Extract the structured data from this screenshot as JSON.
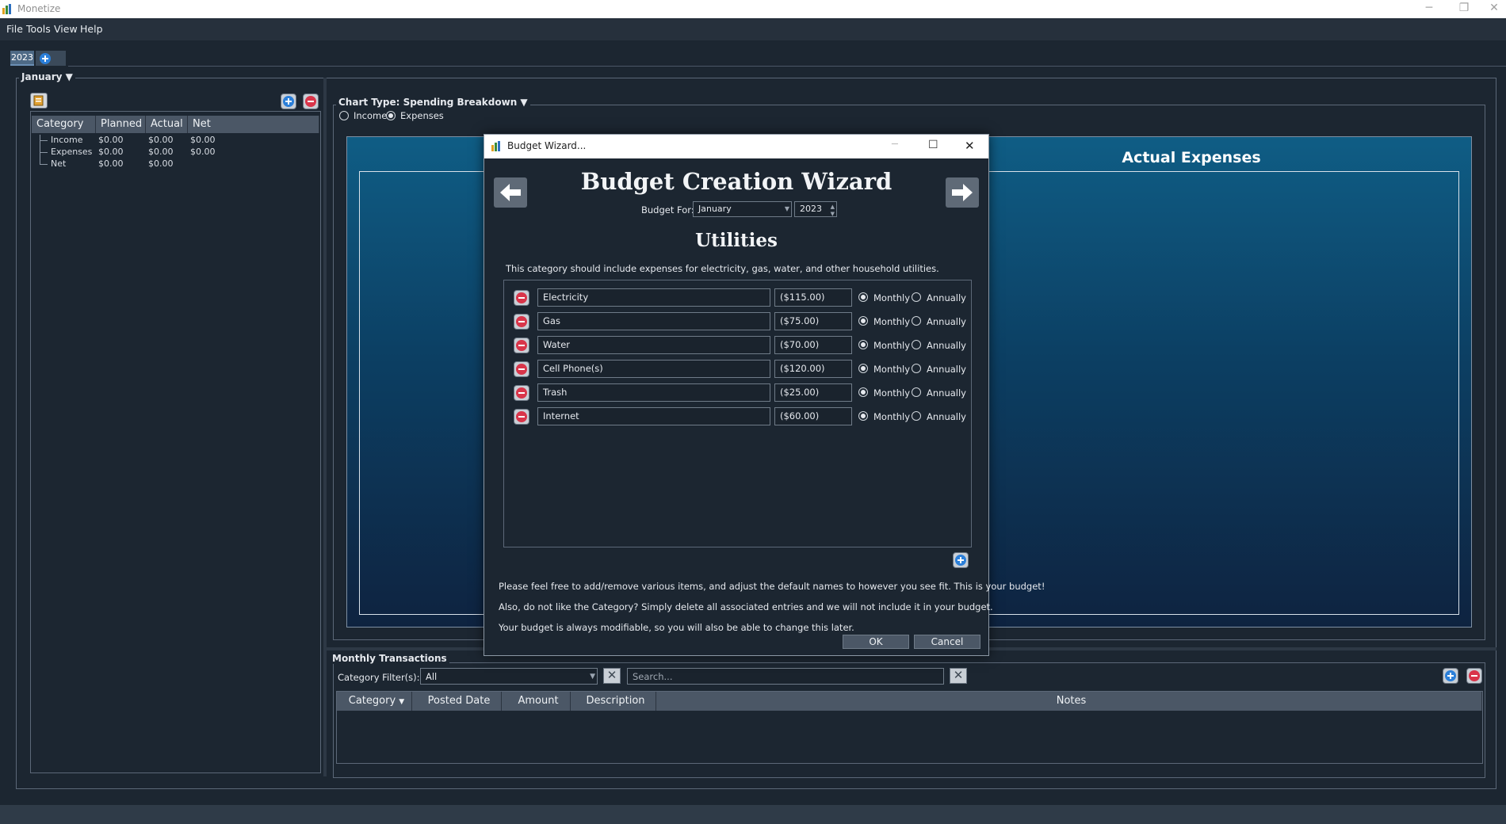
{
  "window": {
    "title": "Monetize",
    "controls": {
      "minimize": "─",
      "restore": "❐",
      "close": "✕"
    }
  },
  "menu": [
    "File",
    "Tools",
    "View",
    "Help"
  ],
  "tabs": {
    "year": "2023"
  },
  "month_selector": {
    "label": "January ▼"
  },
  "summary": {
    "columns": [
      "Category",
      "Planned",
      "Actual",
      "Net"
    ],
    "rows": [
      {
        "name": "Income",
        "planned": "$0.00",
        "actual": "$0.00",
        "net": "$0.00"
      },
      {
        "name": "Expenses",
        "planned": "$0.00",
        "actual": "$0.00",
        "net": "$0.00"
      },
      {
        "name": "Net",
        "planned": "$0.00",
        "actual": "$0.00",
        "net": ""
      }
    ]
  },
  "chart_panel": {
    "chart_type_label": "Chart Type: Spending Breakdown ▼",
    "options": [
      "Income",
      "Expenses"
    ],
    "selected": "Expenses",
    "chart_title": "Actual Expenses"
  },
  "transactions": {
    "title": "Monthly Transactions",
    "filter_label": "Category Filter(s):",
    "filter_value": "All",
    "search_placeholder": "Search...",
    "columns": [
      "Category",
      "Posted Date",
      "Amount",
      "Description",
      "Notes"
    ]
  },
  "wizard": {
    "window_title": "Budget Wizard...",
    "heading": "Budget Creation Wizard",
    "budget_for_label": "Budget For:",
    "month": "January",
    "year": "2023",
    "category": "Utilities",
    "description": "This category should include expenses for electricity, gas, water, and other household utilities.",
    "frequency_options": [
      "Monthly",
      "Annually"
    ],
    "items": [
      {
        "name": "Electricity",
        "amount": "($115.00)"
      },
      {
        "name": "Gas",
        "amount": "($75.00)"
      },
      {
        "name": "Water",
        "amount": "($70.00)"
      },
      {
        "name": "Cell Phone(s)",
        "amount": "($120.00)"
      },
      {
        "name": "Trash",
        "amount": "($25.00)"
      },
      {
        "name": "Internet",
        "amount": "($60.00)"
      }
    ],
    "notes": [
      "Please feel free to add/remove various items, and adjust the default names to however you see fit.  This is your budget!",
      "Also, do not like the Category?  Simply delete all associated entries and we will not include it in your budget.",
      "Your budget is always modifiable, so you will also be able to change this later."
    ],
    "ok_label": "OK",
    "cancel_label": "Cancel"
  }
}
